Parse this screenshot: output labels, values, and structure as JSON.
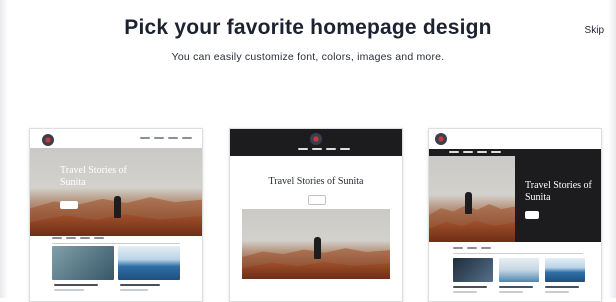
{
  "header": {
    "title": "Pick your favorite homepage design",
    "subtitle": "You can easily customize font, colors, images and more.",
    "skip_label": "Skip"
  },
  "designs": [
    {
      "headline": "Travel Stories of Sunita"
    },
    {
      "headline": "Travel Stories of Sunita"
    },
    {
      "headline": "Travel Stories of Sunita"
    }
  ],
  "colors": {
    "title": "#1d2230",
    "dark_header": "#1c1c1e",
    "accent_logo": "#c43a3a"
  },
  "icons": [
    "design-logo-icon"
  ]
}
